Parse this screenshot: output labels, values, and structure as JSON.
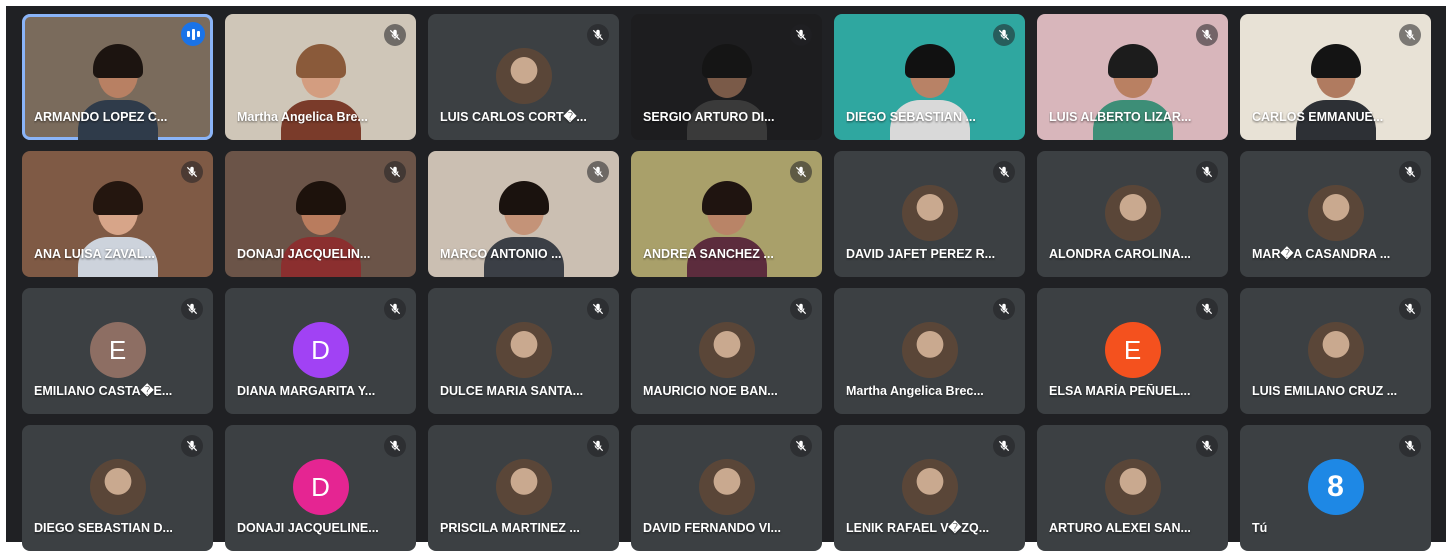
{
  "meeting": {
    "participants": [
      {
        "name": "ARMANDO LOPEZ C...",
        "tile": "video",
        "speaking": true,
        "bg": "#7a6b5c",
        "body": "#2f3b4a",
        "hair": "#1c1410",
        "skin": "#b88063",
        "icon": "speaking-indicator-icon"
      },
      {
        "name": "Martha Angelica Bre...",
        "tile": "video",
        "bg": "#cfc6b8",
        "body": "#7a3b2a",
        "hair": "#8a5a3a",
        "skin": "#d39d80",
        "icon": "mic-off-icon"
      },
      {
        "name": "LUIS CARLOS CORT�...",
        "tile": "avatar",
        "avatar": "photo",
        "icon": "mic-off-icon"
      },
      {
        "name": "SERGIO ARTURO DI...",
        "tile": "video",
        "bg": "#1d1d1f",
        "body": "#3a3a3a",
        "hair": "#151515",
        "skin": "#7a5a48",
        "icon": "mic-off-icon"
      },
      {
        "name": "DIEGO SEBASTIAN ...",
        "tile": "video",
        "bg": "#2fa7a0",
        "body": "#d9d9d9",
        "hair": "#111111",
        "skin": "#b88266",
        "icon": "mic-off-icon"
      },
      {
        "name": "LUIS ALBERTO LIZAR...",
        "tile": "video",
        "bg": "#d8b6bb",
        "body": "#3d8e77",
        "hair": "#1c1c1c",
        "skin": "#b98062",
        "icon": "mic-off-icon"
      },
      {
        "name": "CARLOS EMMANUE...",
        "tile": "video",
        "bg": "#e8e2d6",
        "body": "#2d3035",
        "hair": "#141414",
        "skin": "#b07b60",
        "icon": "mic-off-icon"
      },
      {
        "name": "ANA LUISA ZAVAL...",
        "tile": "video",
        "bg": "#7f5a45",
        "body": "#cdd3dc",
        "hair": "#24160f",
        "skin": "#d7a589",
        "icon": "mic-off-icon"
      },
      {
        "name": "DONAJI JACQUELIN...",
        "tile": "video",
        "bg": "#6b5448",
        "body": "#8b2f2f",
        "hair": "#1d120c",
        "skin": "#b97c5e",
        "icon": "mic-off-icon"
      },
      {
        "name": "MARCO ANTONIO ...",
        "tile": "video",
        "bg": "#cbbfb2",
        "body": "#3b3f46",
        "hair": "#1a120e",
        "skin": "#c49378",
        "icon": "mic-off-icon"
      },
      {
        "name": "ANDREA SANCHEZ ...",
        "tile": "video",
        "bg": "#a9a06a",
        "body": "#5c2c3d",
        "hair": "#1f1410",
        "skin": "#b98467",
        "icon": "mic-off-icon"
      },
      {
        "name": "DAVID JAFET PEREZ R...",
        "tile": "avatar",
        "avatar": "photo",
        "icon": "mic-off-icon"
      },
      {
        "name": "ALONDRA CAROLINA...",
        "tile": "avatar",
        "avatar": "photo",
        "icon": "mic-off-icon"
      },
      {
        "name": "MAR�A CASANDRA ...",
        "tile": "avatar",
        "avatar": "photo",
        "icon": "mic-off-icon"
      },
      {
        "name": "EMILIANO CASTA�E...",
        "tile": "avatar",
        "avatar": "letter",
        "letter": "E",
        "color": "#8d6e63",
        "icon": "mic-off-icon"
      },
      {
        "name": "DIANA MARGARITA Y...",
        "tile": "avatar",
        "avatar": "letter",
        "letter": "D",
        "color": "#a142f4",
        "icon": "mic-off-icon"
      },
      {
        "name": "DULCE MARIA SANTA...",
        "tile": "avatar",
        "avatar": "photo",
        "icon": "mic-off-icon"
      },
      {
        "name": "MAURICIO NOE BAN...",
        "tile": "avatar",
        "avatar": "photo",
        "icon": "mic-off-icon"
      },
      {
        "name": "Martha Angelica Brec...",
        "tile": "avatar",
        "avatar": "photo",
        "icon": "mic-off-icon"
      },
      {
        "name": "ELSA MARÍA PEÑUEL...",
        "tile": "avatar",
        "avatar": "letter",
        "letter": "E",
        "color": "#f4511e",
        "icon": "mic-off-icon"
      },
      {
        "name": "LUIS EMILIANO CRUZ ...",
        "tile": "avatar",
        "avatar": "photo",
        "icon": "mic-off-icon"
      },
      {
        "name": "DIEGO SEBASTIAN D...",
        "tile": "avatar",
        "avatar": "photo",
        "icon": "mic-off-icon"
      },
      {
        "name": "DONAJI JACQUELINE...",
        "tile": "avatar",
        "avatar": "letter",
        "letter": "D",
        "color": "#e52592",
        "icon": "mic-off-icon"
      },
      {
        "name": "PRISCILA MARTINEZ ...",
        "tile": "avatar",
        "avatar": "photo",
        "icon": "mic-off-icon"
      },
      {
        "name": "DAVID FERNANDO VI...",
        "tile": "avatar",
        "avatar": "photo",
        "icon": "mic-off-icon"
      },
      {
        "name": "LENIK RAFAEL V�ZQ...",
        "tile": "avatar",
        "avatar": "photo",
        "icon": "mic-off-icon"
      },
      {
        "name": "ARTURO ALEXEI SAN...",
        "tile": "avatar",
        "avatar": "photo",
        "icon": "mic-off-icon"
      },
      {
        "name": "Tú",
        "tile": "avatar",
        "avatar": "badge",
        "badge_text": "8",
        "color": "#1e88e5",
        "icon": "mic-off-icon"
      }
    ]
  }
}
